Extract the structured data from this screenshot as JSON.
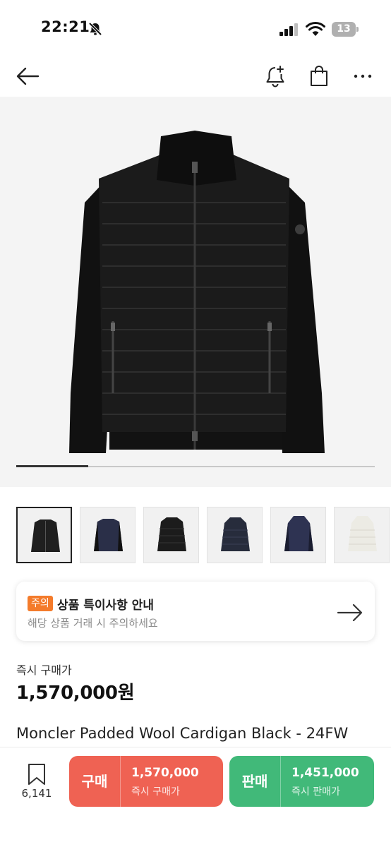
{
  "status_bar": {
    "time": "22:21",
    "battery": "13",
    "icons": [
      "bell-off-icon",
      "signal-icon",
      "wifi-icon",
      "battery-icon"
    ]
  },
  "nav": {
    "icons": [
      "back-arrow-icon",
      "bell-plus-icon",
      "shopping-bag-icon",
      "more-dots-icon"
    ]
  },
  "gallery": {
    "progress": 0.2,
    "thumbnails": [
      {
        "color": "#1f1f1f",
        "selected": true
      },
      {
        "color": "#2a2f48",
        "selected": false
      },
      {
        "color": "#1c1c1c",
        "selected": false
      },
      {
        "color": "#272c3c",
        "selected": false
      },
      {
        "color": "#2e3352",
        "selected": false
      },
      {
        "color": "#ecebe4",
        "selected": false
      }
    ]
  },
  "notice": {
    "badge": "주의",
    "title": "상품 특이사항 안내",
    "subtitle": "해당 상품 거래 시 주의하세요"
  },
  "price": {
    "label": "즉시 구매가",
    "value": "1,570,000원"
  },
  "product": {
    "name": "Moncler Padded Wool Cardigan Black - 24FW"
  },
  "bottom_bar": {
    "wish_count": "6,141",
    "buy": {
      "label": "구매",
      "price": "1,570,000",
      "sub": "즉시 구매가",
      "color": "#ef6253"
    },
    "sell": {
      "label": "판매",
      "price": "1,451,000",
      "sub": "즉시 판매가",
      "color": "#41b979"
    }
  }
}
